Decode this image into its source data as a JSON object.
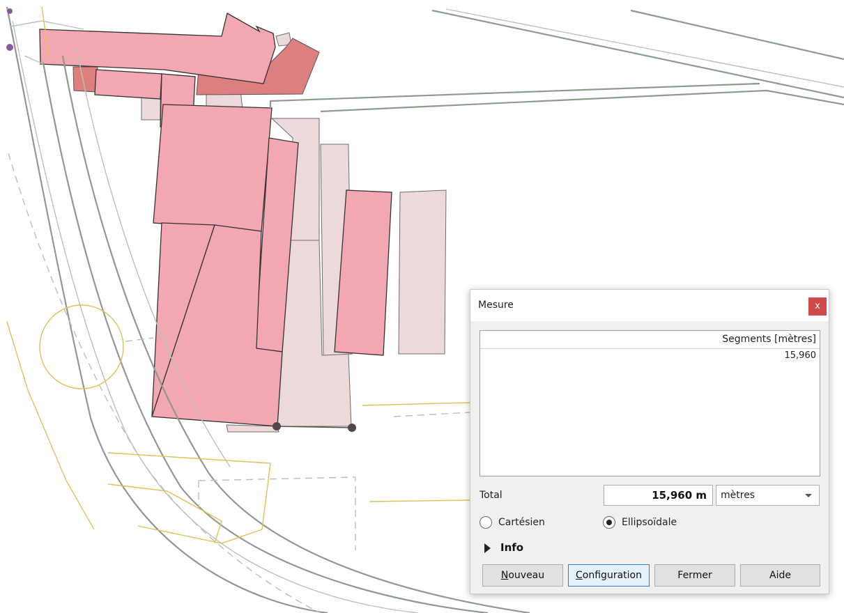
{
  "map": {
    "colors": {
      "building": "#f2a7b3",
      "building_dark": "#dd7f7f",
      "building_light": "#ecd9d9",
      "road": "#8e9a8e",
      "road_secondary": "#b8c2b8",
      "contour": "#e0c05a",
      "dashed": "#bdbdbd",
      "vertex": "#4a4a4a",
      "vertex_purple": "#8a5a9a"
    }
  },
  "dialog": {
    "title": "Mesure",
    "close_icon": "close-icon",
    "close_glyph": "x",
    "table": {
      "header": "Segments [mètres]",
      "rows": [
        "15,960"
      ]
    },
    "total_label": "Total",
    "total_value": "15,960 m",
    "unit": {
      "selected": "mètres",
      "icon": "chevron-down-icon"
    },
    "radios": {
      "cartesian": {
        "label": "Cartésien",
        "selected": false
      },
      "ellipsoidal": {
        "label": "Ellipsoïdale",
        "selected": true
      }
    },
    "info_label": "Info",
    "buttons": {
      "new_mnemonic": "N",
      "new_rest": "ouveau",
      "config_mnemonic": "C",
      "config_rest": "onfiguration",
      "close": "Fermer",
      "help": "Aide"
    }
  }
}
